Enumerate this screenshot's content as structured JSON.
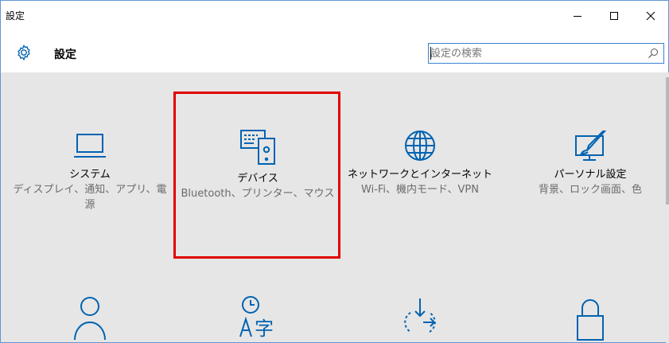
{
  "window": {
    "title": "設定",
    "controls": {
      "minimize": "–",
      "maximize": "☐",
      "close": "✕"
    }
  },
  "header": {
    "title": "設定",
    "search_placeholder": "設定の検索"
  },
  "tiles": [
    {
      "icon": "laptop-icon",
      "label": "システム",
      "desc": "ディスプレイ、通知、アプリ、電源"
    },
    {
      "icon": "devices-icon",
      "label": "デバイス",
      "desc": "Bluetooth、プリンター、マウス"
    },
    {
      "icon": "globe-icon",
      "label": "ネットワークとインターネット",
      "desc": "Wi-Fi、機内モード、VPN"
    },
    {
      "icon": "personalization-icon",
      "label": "パーソナル設定",
      "desc": "背景、ロック画面、色"
    },
    {
      "icon": "person-icon",
      "label": "",
      "desc": ""
    },
    {
      "icon": "time-language-icon",
      "label": "",
      "desc": ""
    },
    {
      "icon": "update-icon",
      "label": "",
      "desc": ""
    },
    {
      "icon": "lock-icon",
      "label": "",
      "desc": ""
    }
  ],
  "highlight": {
    "target": "デバイス",
    "color": "#e10000"
  },
  "colors": {
    "accent": "#3a83d0",
    "background": "#e6e6e6"
  }
}
